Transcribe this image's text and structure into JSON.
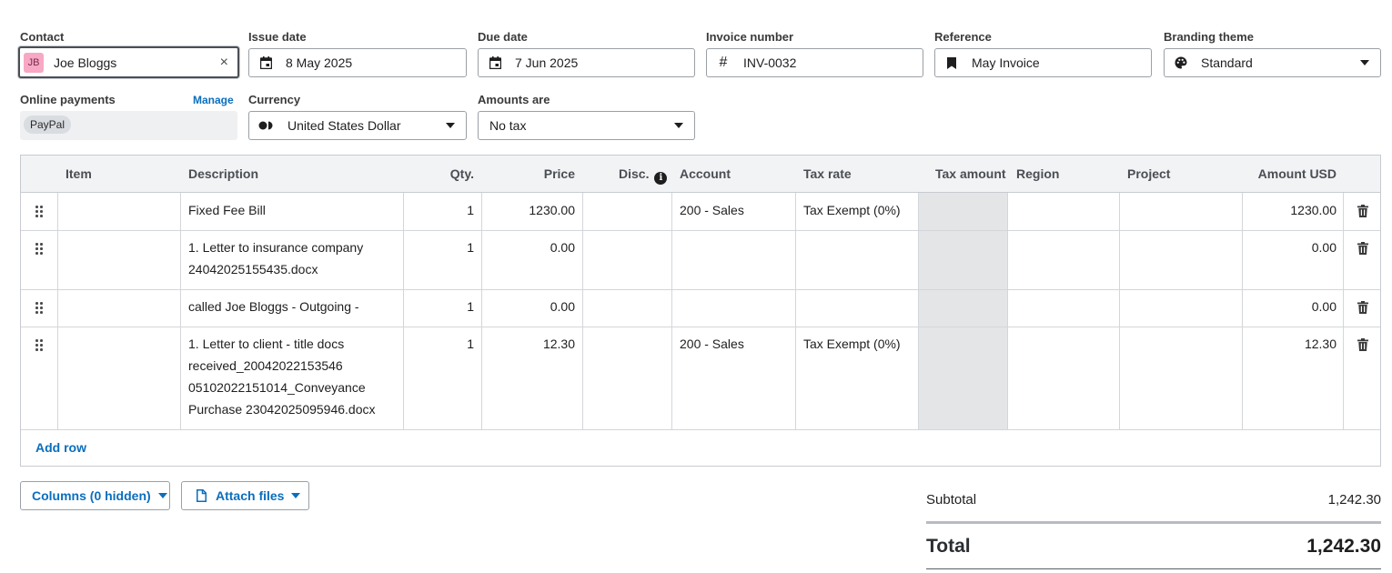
{
  "header": {
    "contact": {
      "label": "Contact",
      "initials": "JB",
      "value": "Joe Bloggs",
      "clear": "×"
    },
    "issue_date": {
      "label": "Issue date",
      "value": "8 May 2025",
      "icon": "calendar-icon"
    },
    "due_date": {
      "label": "Due date",
      "value": "7 Jun 2025",
      "icon": "calendar-icon"
    },
    "invoice_number": {
      "label": "Invoice number",
      "value": "INV-0032",
      "icon": "hash-icon"
    },
    "reference": {
      "label": "Reference",
      "value": "May Invoice",
      "icon": "bookmark-icon"
    },
    "branding_theme": {
      "label": "Branding theme",
      "value": "Standard",
      "icon": "palette-icon"
    },
    "online_payments": {
      "label": "Online payments",
      "manage": "Manage",
      "chip": "PayPal"
    },
    "currency": {
      "label": "Currency",
      "value": "United States Dollar",
      "icon": "currency-icon"
    },
    "amounts_are": {
      "label": "Amounts are",
      "value": "No tax"
    }
  },
  "table": {
    "columns": {
      "item": "Item",
      "description": "Description",
      "qty": "Qty.",
      "price": "Price",
      "disc": "Disc.",
      "account": "Account",
      "tax_rate": "Tax rate",
      "tax_amount": "Tax amount",
      "region": "Region",
      "project": "Project",
      "amount": "Amount USD"
    },
    "rows": [
      {
        "description": [
          "Fixed Fee Bill"
        ],
        "qty": "1",
        "price": "1230.00",
        "account": "200 - Sales",
        "tax_rate": "Tax Exempt (0%)",
        "amount": "1230.00"
      },
      {
        "description": [
          "1. Letter to insurance company",
          "24042025155435.docx"
        ],
        "qty": "1",
        "price": "0.00",
        "account": "",
        "tax_rate": "",
        "amount": "0.00"
      },
      {
        "description": [
          "called Joe Bloggs - Outgoing -"
        ],
        "qty": "1",
        "price": "0.00",
        "account": "",
        "tax_rate": "",
        "amount": "0.00"
      },
      {
        "description": [
          "1. Letter to client - title docs",
          "received_20042022153546",
          "05102022151014_Conveyance",
          "Purchase 23042025095946.docx"
        ],
        "qty": "1",
        "price": "12.30",
        "account": "200 - Sales",
        "tax_rate": "Tax Exempt (0%)",
        "amount": "12.30"
      }
    ],
    "add_row": "Add row"
  },
  "actions": {
    "columns_button": "Columns (0 hidden)",
    "attach_button": "Attach files"
  },
  "totals": {
    "subtotal_label": "Subtotal",
    "subtotal_value": "1,242.30",
    "total_label": "Total",
    "total_value": "1,242.30"
  },
  "colors": {
    "accent": "#0a6ebd",
    "avatar_bg": "#f7a8c4",
    "tax_shade": "#e4e5e7"
  }
}
